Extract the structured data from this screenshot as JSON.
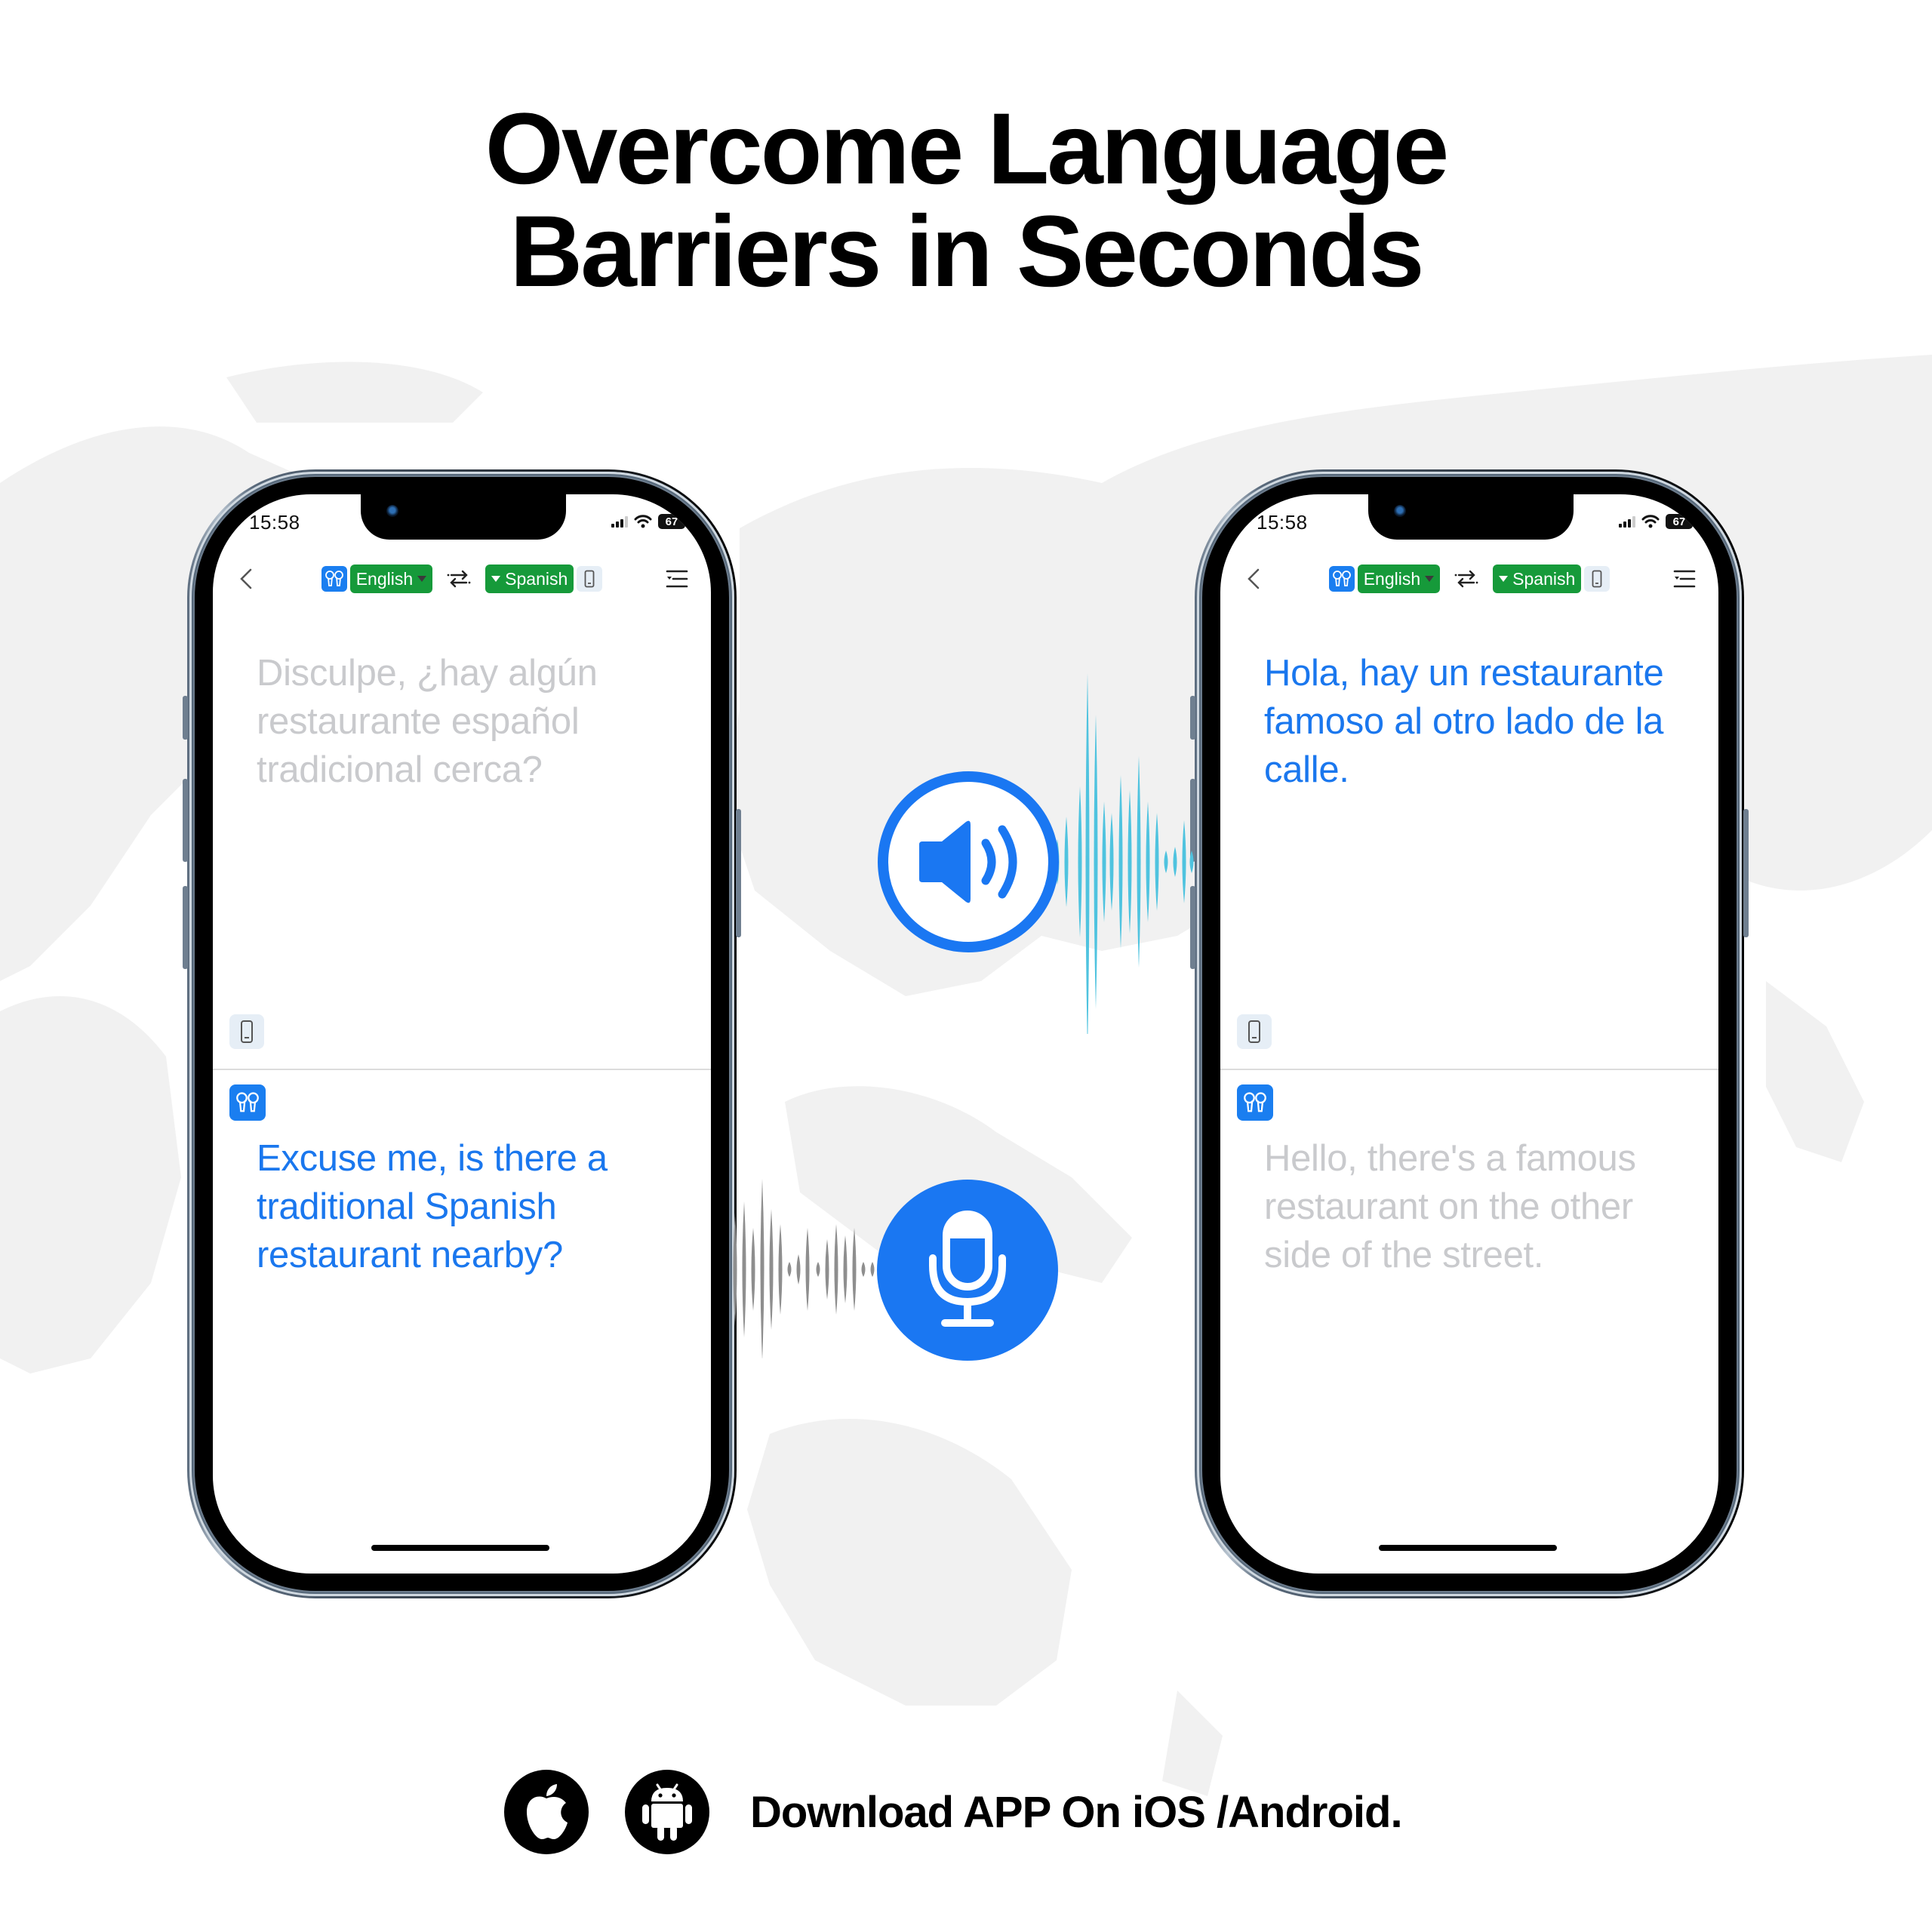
{
  "headline": {
    "line1": "Overcome Language",
    "line2": "Barriers in Seconds"
  },
  "colors": {
    "accent_blue": "#1a77f2",
    "language_green": "#169a3a",
    "muted_text": "#c9cacd",
    "wave_cyan": "#4fc3df",
    "wave_gray": "#8e8e8e"
  },
  "phones": [
    {
      "id": "left",
      "status": {
        "time": "15:58",
        "battery": "67",
        "icons": [
          "signal-icon",
          "wifi-icon",
          "battery-icon"
        ]
      },
      "nav": {
        "back_icon": "chevron-left-icon",
        "source_language": "English",
        "target_language": "Spanish",
        "swap_icon": "swap-arrows-icon",
        "menu_icon": "menu-list-icon"
      },
      "top_pane": {
        "text": "Disculpe, ¿hay algún restaurante español tradicional cerca?",
        "state": "muted",
        "device_icon": "phone-icon"
      },
      "bottom_pane": {
        "text": "Excuse me, is there a traditional Spanish restaurant nearby?",
        "state": "active",
        "device_icon": "earbuds-icon"
      }
    },
    {
      "id": "right",
      "status": {
        "time": "15:58",
        "battery": "67",
        "icons": [
          "signal-icon",
          "wifi-icon",
          "battery-icon"
        ]
      },
      "nav": {
        "back_icon": "chevron-left-icon",
        "source_language": "English",
        "target_language": "Spanish",
        "swap_icon": "swap-arrows-icon",
        "menu_icon": "menu-list-icon"
      },
      "top_pane": {
        "text": "Hola, hay un restaurante famoso al otro lado de la calle.",
        "state": "active",
        "device_icon": "phone-icon"
      },
      "bottom_pane": {
        "text": "Hello, there's a famous restaurant on the other side of the street.",
        "state": "muted",
        "device_icon": "earbuds-icon"
      }
    }
  ],
  "center_controls": {
    "speaker_icon": "speaker-volume-icon",
    "mic_icon": "microphone-icon"
  },
  "footer": {
    "store_icons": [
      "apple-icon",
      "android-icon"
    ],
    "text": "Download APP On iOS /Android."
  }
}
